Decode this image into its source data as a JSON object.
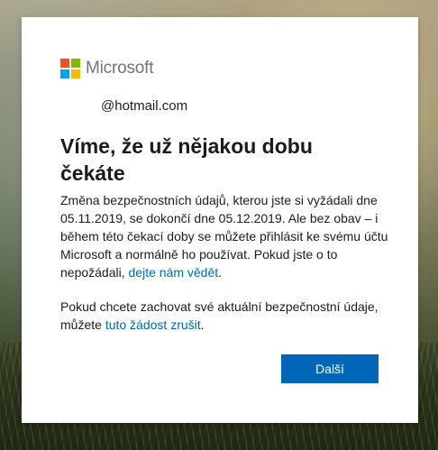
{
  "brand": {
    "name": "Microsoft",
    "logo_colors": [
      "#f25022",
      "#7fba00",
      "#00a4ef",
      "#ffb900"
    ]
  },
  "identity": {
    "email": "@hotmail.com"
  },
  "dialog": {
    "title": "Víme, že už nějakou dobu čekáte",
    "paragraph1_text": "Změna bezpečnostních údajů, kterou jste si vyžádali dne 05.11.2019, se dokončí dne 05.12.2019. Ale bez obav – i během této čekací doby se můžete přihlásit ke svému účtu Microsoft a normálně ho používat. Pokud jste o to nepožádali, ",
    "paragraph1_link": "dejte nám vědět",
    "paragraph1_end": ".",
    "paragraph2_text": "Pokud chcete zachovat své aktuální bezpečnostní údaje, můžete ",
    "paragraph2_link": "tuto žádost zrušit",
    "paragraph2_end": ".",
    "next_button_label": "Další"
  },
  "colors": {
    "accent": "#0067b8",
    "text": "#1b1b1b",
    "brand_gray": "#737373"
  }
}
